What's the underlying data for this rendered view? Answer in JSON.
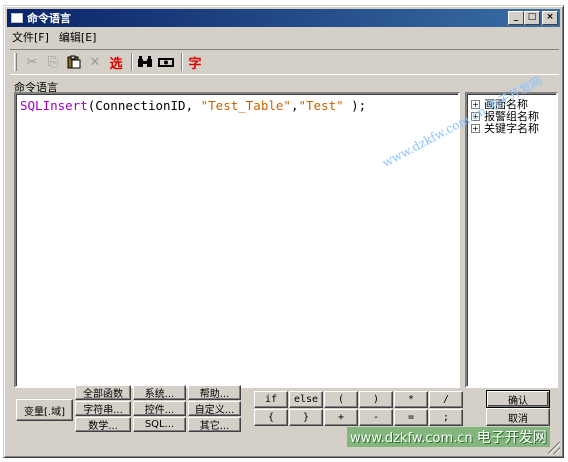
{
  "window": {
    "title": "命令语言",
    "controls": {
      "minimize": "_",
      "maximize": "□",
      "close": "×"
    }
  },
  "menu": [
    "文件[F]",
    "编辑[E]"
  ],
  "toolbar": {
    "icons": [
      "cut-icon",
      "copy-icon",
      "paste-icon",
      "delete-icon",
      "select-icon",
      "find-icon",
      "replace-icon",
      "char-icon"
    ],
    "select_label": "选",
    "char_label": "字",
    "find_glyph": "⌕⌕",
    "replace_glyph": "⇌"
  },
  "editor": {
    "label": "命令语言",
    "code": {
      "func": "SQLInsert",
      "open": "(ConnectionID, ",
      "arg1": "\"Test_Table\"",
      "comma": ",",
      "arg2": "\"Test\"",
      "close": " );"
    }
  },
  "tree": {
    "items": [
      "画面名称",
      "报警组名称",
      "关键字名称"
    ]
  },
  "buttons": {
    "var": "变量[.域]",
    "all_func": "全部函数",
    "system": "系统...",
    "help": "帮助...",
    "string": "字符串...",
    "control": "控件...",
    "custom": "自定义...",
    "math": "数学...",
    "sql": "SQL...",
    "other": "其它...",
    "ok": "确认",
    "cancel": "取消"
  },
  "operators": {
    "row1": [
      "if",
      "else",
      "(",
      ")",
      "*",
      "/"
    ],
    "row2": [
      "{",
      "}",
      "+",
      "-",
      "=",
      ";"
    ]
  },
  "watermarks": {
    "diagonal": "www.dzkfw.com.cn 电子开发网",
    "bottom_url": "www.dzkfw.com.cn",
    "bottom_cn": "电子开发网"
  }
}
